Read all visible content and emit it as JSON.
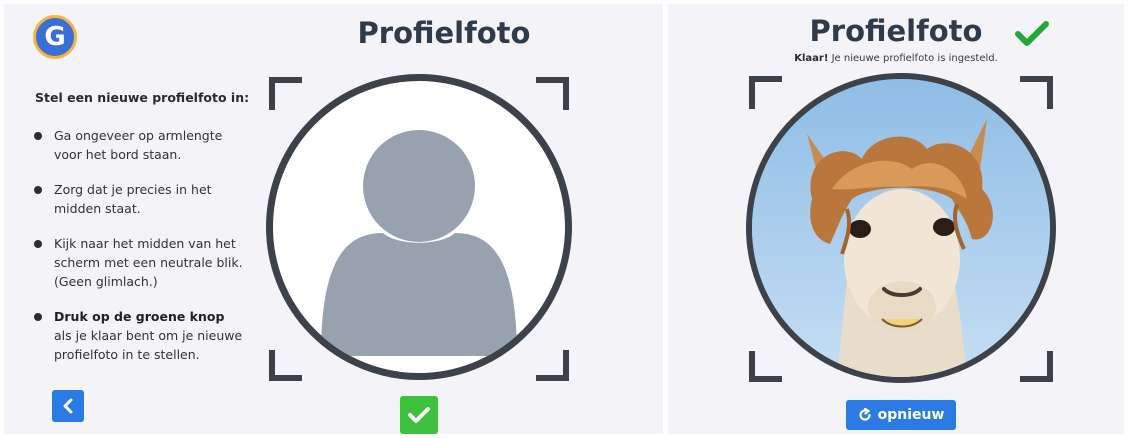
{
  "left_screen": {
    "logo_letter": "G",
    "title": "Profielfoto",
    "instructions_heading": "Stel een nieuwe profielfoto in:",
    "instructions": [
      {
        "text": "Ga ongeveer op armlengte voor het bord staan."
      },
      {
        "text": "Zorg dat je precies in het midden staat."
      },
      {
        "text": "Kijk naar het midden van het scherm met een neutrale blik. (Geen glimlach.)"
      },
      {
        "bold": "Druk op de groene knop",
        "text": " als je klaar bent om je nieuwe profielfoto in te stellen."
      }
    ],
    "back_icon": "chevron-left-icon",
    "confirm_icon": "checkmark-icon",
    "placeholder_icon": "user-silhouette-icon"
  },
  "right_screen": {
    "title": "Profielfoto",
    "status_bold": "Klaar!",
    "status_text": " Je nieuwe profielfoto is ingesteld.",
    "status_icon": "checkmark-icon",
    "retry_label": "opnieuw",
    "retry_icon": "refresh-icon",
    "photo_subject": "alpaca-photo"
  },
  "colors": {
    "panel_bg": "#f4f4f8",
    "blue_button": "#2c7be5",
    "green_button": "#3ec23e",
    "check_green": "#22a83a",
    "frame_dark": "#3d4149",
    "silhouette": "#98a2ae"
  }
}
